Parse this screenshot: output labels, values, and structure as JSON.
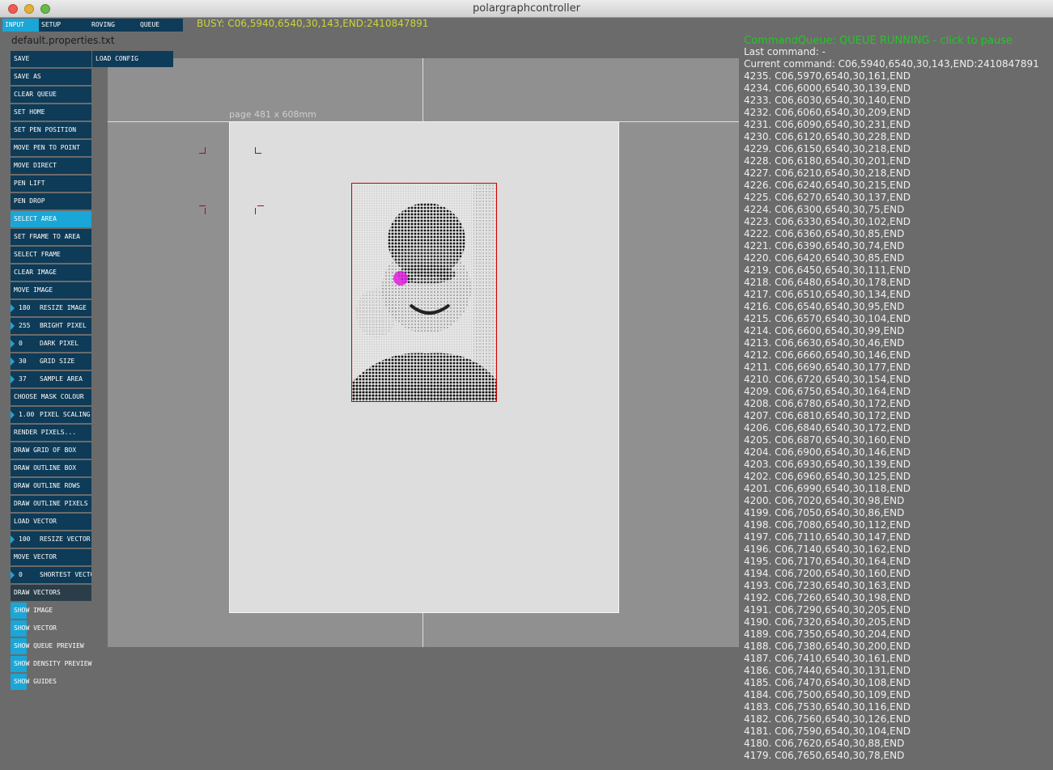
{
  "window": {
    "title": "polargraphcontroller"
  },
  "tabs": [
    "INPUT",
    "SETUP",
    "ROVING",
    "QUEUE"
  ],
  "busy_text": "BUSY: C06,5940,6540,30,143,END:2410847891",
  "properties_file": "default.properties.txt",
  "buttons": {
    "save": "SAVE",
    "load_config": "LOAD CONFIG",
    "save_as": "SAVE AS",
    "clear_queue": "CLEAR QUEUE",
    "set_home": "SET HOME",
    "set_pen_position": "SET PEN POSITION",
    "move_pen_to_point": "MOVE PEN TO POINT",
    "move_direct": "MOVE DIRECT",
    "pen_lift": "PEN LIFT",
    "pen_drop": "PEN DROP",
    "select_area": "SELECT AREA",
    "set_frame_to_area": "SET FRAME TO AREA",
    "select_frame": "SELECT FRAME",
    "clear_image": "CLEAR IMAGE",
    "move_image": "MOVE IMAGE",
    "choose_mask_colour": "CHOOSE MASK COLOUR",
    "render_pixels": "RENDER PIXELS...",
    "draw_grid_of_box": "DRAW GRID OF BOX",
    "draw_outline_box": "DRAW OUTLINE BOX",
    "draw_outline_rows": "DRAW OUTLINE ROWS",
    "draw_outline_pixels": "DRAW OUTLINE PIXELS",
    "load_vector": "LOAD VECTOR",
    "move_vector": "MOVE VECTOR",
    "draw_vectors": "DRAW VECTORS"
  },
  "numeric_controls": {
    "resize_image": {
      "value": "180",
      "label": "RESIZE IMAGE"
    },
    "bright_pixel": {
      "value": "255",
      "label": "BRIGHT PIXEL"
    },
    "dark_pixel": {
      "value": "0",
      "label": "DARK PIXEL"
    },
    "grid_size": {
      "value": "30",
      "label": "GRID SIZE"
    },
    "sample_area": {
      "value": "37",
      "label": "SAMPLE AREA"
    },
    "pixel_scaling": {
      "value": "1.00",
      "label": "PIXEL SCALING"
    },
    "resize_vector": {
      "value": "100",
      "label": "RESIZE VECTOR"
    },
    "shortest_vector": {
      "value": "0",
      "label": "SHORTEST VECTOR"
    }
  },
  "toggles": {
    "show_image": "SHOW IMAGE",
    "show_vector": "SHOW VECTOR",
    "show_queue_preview": "SHOW QUEUE PREVIEW",
    "show_density_preview": "SHOW DENSITY PREVIEW",
    "show_guides": "SHOW GUIDES"
  },
  "page_label": "page 481 x 608mm",
  "queue": {
    "status": "CommandQueue: QUEUE RUNNING - click to pause",
    "last_command": "Last command: -",
    "current_command": "Current command: C06,5940,6540,30,143,END:2410847891",
    "items": [
      "4235. C06,5970,6540,30,161,END",
      "4234. C06,6000,6540,30,139,END",
      "4233. C06,6030,6540,30,140,END",
      "4232. C06,6060,6540,30,209,END",
      "4231. C06,6090,6540,30,231,END",
      "4230. C06,6120,6540,30,228,END",
      "4229. C06,6150,6540,30,218,END",
      "4228. C06,6180,6540,30,201,END",
      "4227. C06,6210,6540,30,218,END",
      "4226. C06,6240,6540,30,215,END",
      "4225. C06,6270,6540,30,137,END",
      "4224. C06,6300,6540,30,75,END",
      "4223. C06,6330,6540,30,102,END",
      "4222. C06,6360,6540,30,85,END",
      "4221. C06,6390,6540,30,74,END",
      "4220. C06,6420,6540,30,85,END",
      "4219. C06,6450,6540,30,111,END",
      "4218. C06,6480,6540,30,178,END",
      "4217. C06,6510,6540,30,134,END",
      "4216. C06,6540,6540,30,95,END",
      "4215. C06,6570,6540,30,104,END",
      "4214. C06,6600,6540,30,99,END",
      "4213. C06,6630,6540,30,46,END",
      "4212. C06,6660,6540,30,146,END",
      "4211. C06,6690,6540,30,177,END",
      "4210. C06,6720,6540,30,154,END",
      "4209. C06,6750,6540,30,164,END",
      "4208. C06,6780,6540,30,172,END",
      "4207. C06,6810,6540,30,172,END",
      "4206. C06,6840,6540,30,172,END",
      "4205. C06,6870,6540,30,160,END",
      "4204. C06,6900,6540,30,146,END",
      "4203. C06,6930,6540,30,139,END",
      "4202. C06,6960,6540,30,125,END",
      "4201. C06,6990,6540,30,118,END",
      "4200. C06,7020,6540,30,98,END",
      "4199. C06,7050,6540,30,86,END",
      "4198. C06,7080,6540,30,112,END",
      "4197. C06,7110,6540,30,147,END",
      "4196. C06,7140,6540,30,162,END",
      "4195. C06,7170,6540,30,164,END",
      "4194. C06,7200,6540,30,160,END",
      "4193. C06,7230,6540,30,163,END",
      "4192. C06,7260,6540,30,198,END",
      "4191. C06,7290,6540,30,205,END",
      "4190. C06,7320,6540,30,205,END",
      "4189. C06,7350,6540,30,204,END",
      "4188. C06,7380,6540,30,200,END",
      "4187. C06,7410,6540,30,161,END",
      "4186. C06,7440,6540,30,131,END",
      "4185. C06,7470,6540,30,108,END",
      "4184. C06,7500,6540,30,109,END",
      "4183. C06,7530,6540,30,116,END",
      "4182. C06,7560,6540,30,126,END",
      "4181. C06,7590,6540,30,104,END",
      "4180. C06,7620,6540,30,88,END",
      "4179. C06,7650,6540,30,78,END"
    ]
  },
  "colors": {
    "button": "#0e3b57",
    "active": "#1aa6d6",
    "busy_text": "#c9d63a",
    "queue_status": "#27c42a",
    "frame_red": "#d10000",
    "pen_marker": "#e020e0"
  },
  "icons": [
    "close-icon",
    "minimize-icon",
    "maximize-icon",
    "arrow-right-icon"
  ]
}
